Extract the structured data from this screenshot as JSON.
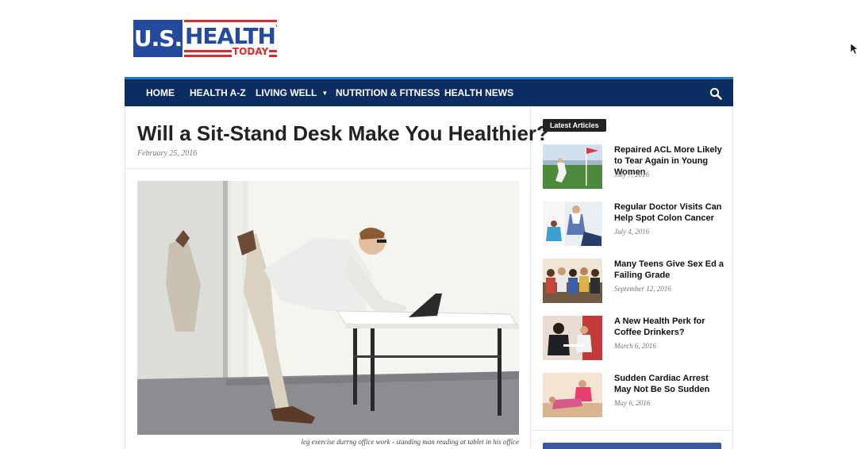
{
  "logo": {
    "us": "U.S.",
    "health": "HEALTH",
    "today": "TODAY"
  },
  "nav": {
    "items": [
      {
        "label": "HOME"
      },
      {
        "label": "HEALTH A-Z"
      },
      {
        "label": "LIVING WELL"
      },
      {
        "label": "NUTRITION & FITNESS"
      },
      {
        "label": "HEALTH NEWS"
      }
    ],
    "search_icon": "search-icon",
    "bar_color": "#0b2d61",
    "accent_color": "#1f7bc0"
  },
  "article": {
    "title": "Will a Sit-Stand Desk Make You Healthier?",
    "date": "February 25, 2016",
    "caption": "leg exercise durrng office work - standing man reading at tablet in his office"
  },
  "sidebar": {
    "heading": "Latest Articles",
    "items": [
      {
        "title": "Repaired ACL More Likely to Tear Again in Young Women",
        "date": "July 7, 2016"
      },
      {
        "title": "Regular Doctor Visits Can Help Spot Colon Cancer",
        "date": "July 4, 2016"
      },
      {
        "title": "Many Teens Give Sex Ed a Failing Grade",
        "date": "September 12, 2016"
      },
      {
        "title": "A New Health Perk for Coffee Drinkers?",
        "date": "March 6, 2016"
      },
      {
        "title": "Sudden Cardiac Arrest May Not Be So Sudden",
        "date": "May 6, 2016"
      }
    ]
  }
}
